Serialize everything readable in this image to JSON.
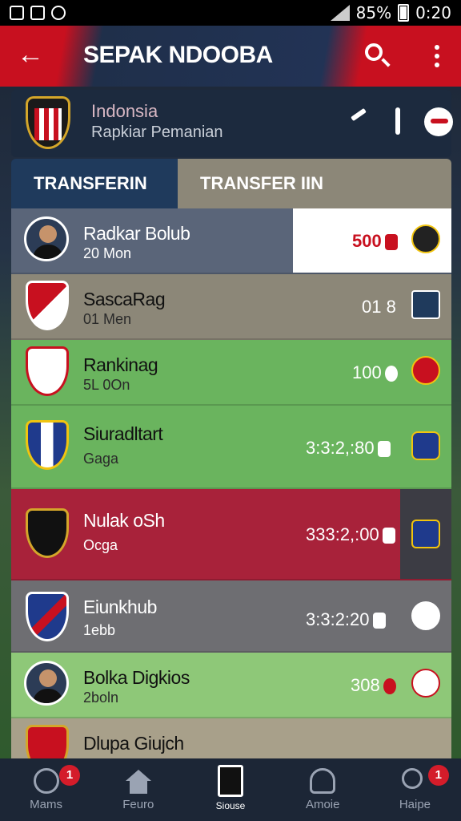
{
  "status_bar": {
    "battery": "85%",
    "time": "0:20"
  },
  "header": {
    "title": "SEPAK NDOOBA"
  },
  "team": {
    "name": "Indonsia",
    "subtitle": "Rapkiar Pemanian"
  },
  "tabs": [
    {
      "label": "TRANSFERIN",
      "active": true
    },
    {
      "label": "TRANSFER IIN",
      "active": false
    }
  ],
  "players": [
    {
      "name": "Radkar Bolub",
      "sub": "20 Mon",
      "value": "500"
    },
    {
      "name": "SascaRag",
      "sub": "01 Men",
      "value": "01 8"
    },
    {
      "name": "Rankinag",
      "sub": "5L 0On",
      "value": "100"
    },
    {
      "name": "Siuradltart",
      "sub": "Gaga",
      "value": "3:3:2,:80"
    },
    {
      "name": "Nulak oSh",
      "sub": "Ocga",
      "value": "333:2,:00"
    },
    {
      "name": "Eiunkhub",
      "sub": "1ebb",
      "value": "3:3:2:20"
    },
    {
      "name": "Bolka Digkios",
      "sub": "2boln",
      "value": "308"
    },
    {
      "name": "Dlupa Giujch",
      "sub": "",
      "value": ""
    }
  ],
  "nav": [
    {
      "label": "Mams",
      "badge": "1"
    },
    {
      "label": "Feuro",
      "badge": ""
    },
    {
      "label": "Siouse",
      "badge": ""
    },
    {
      "label": "Amoie",
      "badge": ""
    },
    {
      "label": "Haipe",
      "badge": "1"
    }
  ],
  "colors": {
    "accent": "#c8101f",
    "navy": "#1f3a5c",
    "green": "#6ab45e",
    "maroon": "#a8223a"
  }
}
